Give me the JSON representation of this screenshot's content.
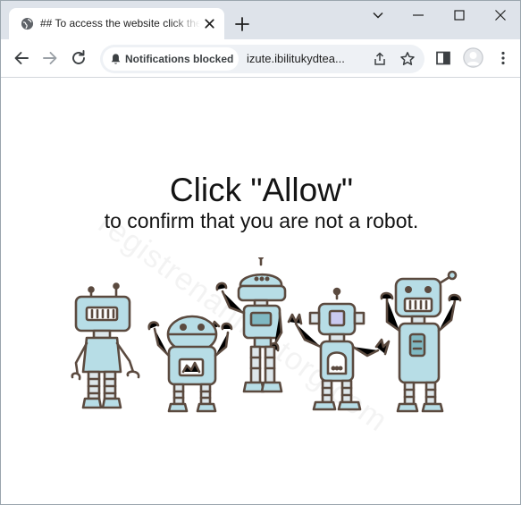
{
  "browser": {
    "tab": {
      "title": "## To access the website click the",
      "favicon": "globe-icon"
    },
    "window_controls": [
      "chevron-down-icon",
      "minimize-icon",
      "maximize-icon",
      "close-icon"
    ],
    "toolbar": {
      "notification_chip_label": "Notifications blocked",
      "url": "izute.ibilitukydtea...",
      "icons": [
        "back-icon",
        "forward-icon",
        "reload-icon",
        "bell-slash-icon",
        "share-icon",
        "star-icon",
        "sidepanel-icon",
        "profile-avatar",
        "kebab-menu-icon"
      ]
    }
  },
  "page": {
    "headline": "Click \"Allow\"",
    "subline": "to confirm that you are not a robot.",
    "watermark": "registrenanimatorg.com",
    "illustration": "five-cartoon-robots"
  },
  "colors": {
    "tabstrip": "#dee3ea",
    "omnibox": "#eef1f5",
    "robot_fill": "#b7dde6",
    "robot_outline": "#5b4a3f"
  }
}
